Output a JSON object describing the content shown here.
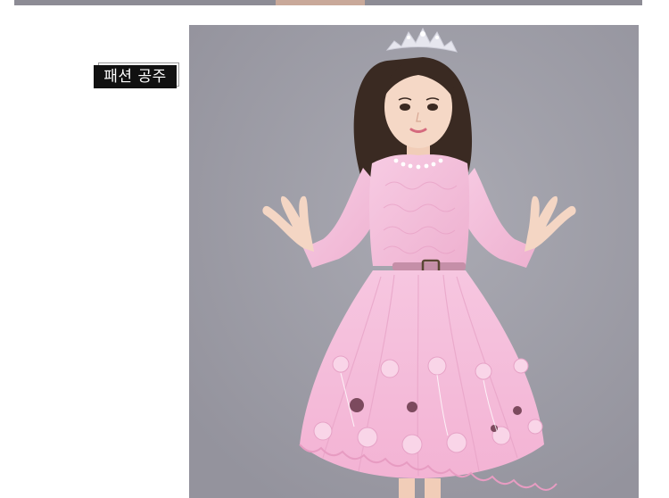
{
  "caption": {
    "label": "패션 공주"
  },
  "photo": {
    "subject": "girl-in-pink-lace-dress"
  },
  "colors": {
    "caption_bg": "#111111",
    "caption_text": "#ffffff",
    "photo_bg": "#9e9da7",
    "dress_pink": "#f2b8d6"
  }
}
